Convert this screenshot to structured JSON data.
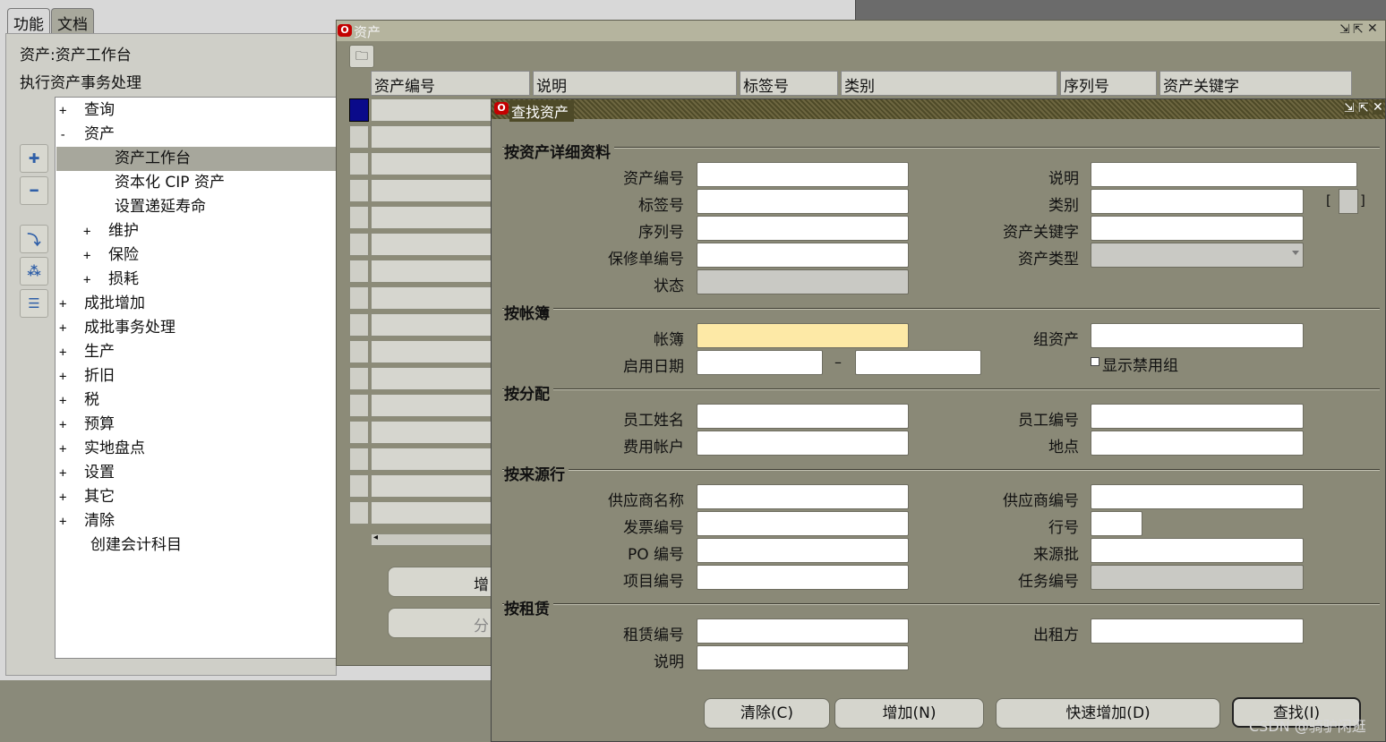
{
  "navigator": {
    "tabs": [
      "功能",
      "文档"
    ],
    "responsibility": "资产:资产工作台",
    "instruction": "执行资产事务处理",
    "tree": [
      {
        "toggle": "+",
        "label": "查询"
      },
      {
        "toggle": "-",
        "label": "资产"
      },
      {
        "toggle": "",
        "label": "资产工作台"
      },
      {
        "toggle": "",
        "label": "资本化 CIP 资产"
      },
      {
        "toggle": "",
        "label": "设置递延寿命"
      },
      {
        "toggle": "+",
        "label": "维护"
      },
      {
        "toggle": "+",
        "label": "保险"
      },
      {
        "toggle": "+",
        "label": "损耗"
      },
      {
        "toggle": "+",
        "label": "成批增加"
      },
      {
        "toggle": "+",
        "label": "成批事务处理"
      },
      {
        "toggle": "+",
        "label": "生产"
      },
      {
        "toggle": "+",
        "label": "折旧"
      },
      {
        "toggle": "+",
        "label": "税"
      },
      {
        "toggle": "+",
        "label": "预算"
      },
      {
        "toggle": "+",
        "label": "实地盘点"
      },
      {
        "toggle": "+",
        "label": "设置"
      },
      {
        "toggle": "+",
        "label": "其它"
      },
      {
        "toggle": "+",
        "label": "清除"
      },
      {
        "toggle": "",
        "label": "创建会计科目"
      }
    ],
    "side_buttons": [
      "expand-icon",
      "collapse-icon",
      "expand-branch-icon",
      "expand-all-icon",
      "collapse-all-icon"
    ]
  },
  "assets_window": {
    "title": "资产",
    "columns": [
      "资产编号",
      "说明",
      "标签号",
      "类别",
      "序列号",
      "资产关键字"
    ],
    "buttons": [
      "增",
      "分"
    ]
  },
  "find_dialog": {
    "title": "查找资产",
    "sections": {
      "details": "按资产详细资料",
      "book": "按帐簿",
      "assignment": "按分配",
      "source": "按来源行",
      "lease": "按租赁"
    },
    "labels": {
      "asset_number": "资产编号",
      "description": "说明",
      "tag_number": "标签号",
      "category": "类别",
      "serial_number": "序列号",
      "asset_key": "资产关键字",
      "warranty_number": "保修单编号",
      "asset_type": "资产类型",
      "status": "状态",
      "book": "帐簿",
      "group_asset": "组资产",
      "date_in_service": "启用日期",
      "date_sep": "–",
      "show_disabled_groups": "显示禁用组",
      "employee_name": "员工姓名",
      "employee_number": "员工编号",
      "expense_account": "费用帐户",
      "location": "地点",
      "supplier_name": "供应商名称",
      "supplier_number": "供应商编号",
      "invoice_number": "发票编号",
      "line_number": "行号",
      "po_number": "PO 编号",
      "source_batch": "来源批",
      "project_number": "项目编号",
      "task_number": "任务编号",
      "lease_number": "租赁编号",
      "lessor": "出租方",
      "lease_description": "说明"
    },
    "buttons": {
      "clear": "清除(C)",
      "add": "增加(N)",
      "quick_add": "快速增加(D)",
      "find": "查找(I)"
    }
  },
  "watermark": "CSDN @骑驴闲逛"
}
